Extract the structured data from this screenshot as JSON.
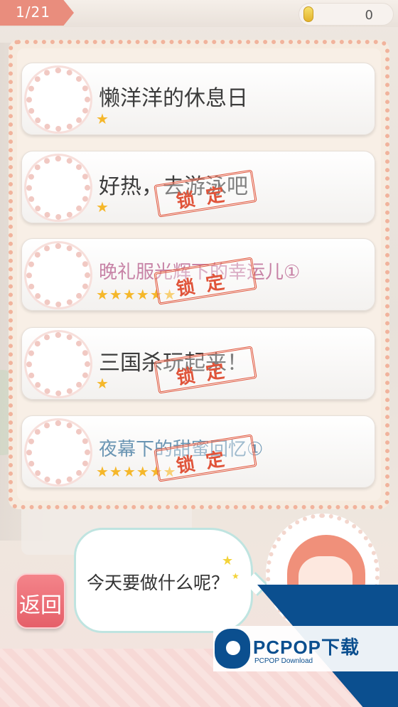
{
  "header": {
    "level_progress": "1/21",
    "coin_icon": "coin-icon",
    "coins": "0"
  },
  "levels": [
    {
      "title": "懒洋洋的休息日",
      "stars": "★",
      "locked": false,
      "style": "normal"
    },
    {
      "title": "好热，去游泳吧",
      "stars": "★",
      "locked": true,
      "style": "normal"
    },
    {
      "title": "晚礼服光辉下的幸运儿①",
      "stars": "★★★★★★",
      "locked": true,
      "style": "pink"
    },
    {
      "title": "三国杀玩起来！",
      "stars": "★",
      "locked": true,
      "style": "normal"
    },
    {
      "title": "夜幕下的甜蜜回忆①",
      "stars": "★★★★★★",
      "locked": true,
      "style": "blue"
    }
  ],
  "lock_label": "锁定",
  "back_label": "返回",
  "dialogue": "今天要做什么呢？",
  "watermark": {
    "title": "PCPOP下载",
    "subtitle": "PCPOP Download"
  },
  "colors": {
    "accent": "#e98d7d",
    "lock": "#e0543a",
    "star": "#f5b72a",
    "watermark": "#0b4f8f"
  }
}
